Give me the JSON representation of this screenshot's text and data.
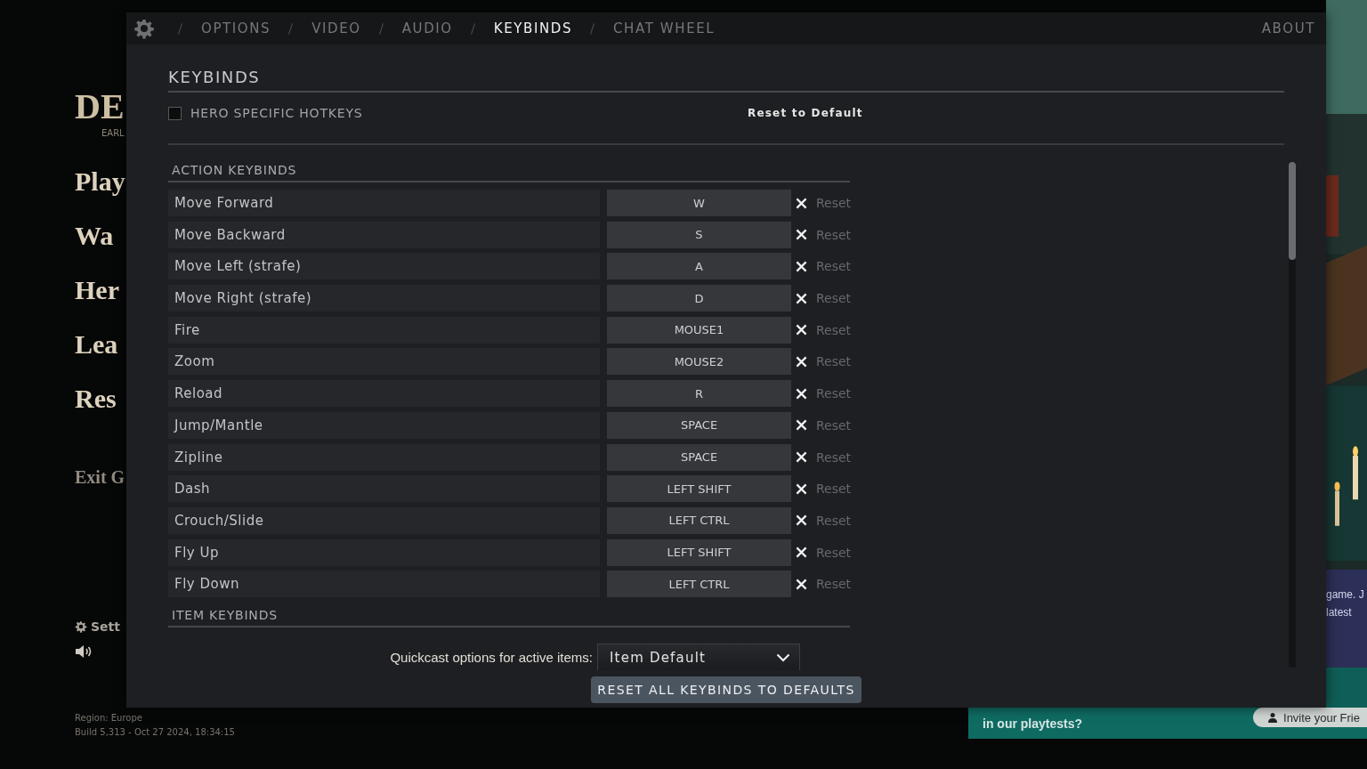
{
  "background_menu": {
    "logo": "DE",
    "logo_subtitle": "EARL",
    "items": [
      {
        "label": "Play"
      },
      {
        "label": "Wa"
      },
      {
        "label": "Her"
      },
      {
        "label": "Lea"
      },
      {
        "label": "Res"
      }
    ],
    "exit": "Exit G",
    "settings": "Sett"
  },
  "side_panel": {
    "lines": [
      "game. J",
      "latest"
    ]
  },
  "build_info": {
    "region": "Region: Europe",
    "build": "Build 5,313 - Oct 27 2024, 18:34:15"
  },
  "banner": {
    "text": "in our playtests?",
    "button": "Invite your Frie"
  },
  "dialog": {
    "tabs": [
      {
        "label": "OPTIONS",
        "selected": false
      },
      {
        "label": "VIDEO",
        "selected": false
      },
      {
        "label": "AUDIO",
        "selected": false
      },
      {
        "label": "KEYBINDS",
        "selected": true
      },
      {
        "label": "CHAT WHEEL",
        "selected": false
      }
    ],
    "about": "ABOUT",
    "title": "KEYBINDS",
    "hero_specific": {
      "label": "HERO SPECIFIC HOTKEYS",
      "checked": false
    },
    "reset_to_default": "Reset to Default",
    "sections": [
      {
        "kind": "bindings",
        "title": "ACTION KEYBINDS",
        "rows": [
          {
            "action": "Move Forward",
            "key": "W",
            "reset": "Reset"
          },
          {
            "action": "Move Backward",
            "key": "S",
            "reset": "Reset"
          },
          {
            "action": "Move Left (strafe)",
            "key": "A",
            "reset": "Reset"
          },
          {
            "action": "Move Right (strafe)",
            "key": "D",
            "reset": "Reset"
          },
          {
            "action": "Fire",
            "key": "MOUSE1",
            "reset": "Reset"
          },
          {
            "action": "Zoom",
            "key": "MOUSE2",
            "reset": "Reset"
          },
          {
            "action": "Reload",
            "key": "R",
            "reset": "Reset"
          },
          {
            "action": "Jump/Mantle",
            "key": "SPACE",
            "reset": "Reset"
          },
          {
            "action": "Zipline",
            "key": "SPACE",
            "reset": "Reset"
          },
          {
            "action": "Dash",
            "key": "LEFT SHIFT",
            "reset": "Reset"
          },
          {
            "action": "Crouch/Slide",
            "key": "LEFT CTRL",
            "reset": "Reset"
          },
          {
            "action": "Fly Up",
            "key": "LEFT SHIFT",
            "reset": "Reset"
          },
          {
            "action": "Fly Down",
            "key": "LEFT CTRL",
            "reset": "Reset"
          }
        ]
      },
      {
        "kind": "options",
        "title": "ITEM KEYBINDS",
        "quickcast": {
          "label": "Quickcast options for active items:",
          "value": "Item Default"
        }
      }
    ],
    "reset_all": "RESET ALL KEYBINDS TO DEFAULTS"
  }
}
